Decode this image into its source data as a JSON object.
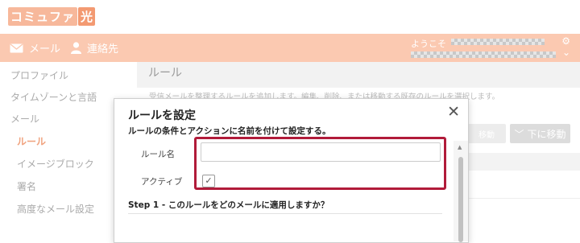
{
  "brand": {
    "logo_text": "コミュファ",
    "logo_hikari": "光"
  },
  "topnav": {
    "mail_label": "メール",
    "contacts_label": "連絡先",
    "welcome": "ようこそ"
  },
  "sidebar": {
    "items": [
      {
        "label": "プロファイル"
      },
      {
        "label": "タイムゾーンと言語"
      },
      {
        "label": "メール"
      },
      {
        "label": "ルール"
      },
      {
        "label": "イメージブロック"
      },
      {
        "label": "署名"
      },
      {
        "label": "高度なメール設定"
      }
    ]
  },
  "main": {
    "title": "ルール",
    "description": "受信メールを整理するルールを追加します。編集、削除、または移動する既存のルールを選択します。",
    "move_up_label": "移動",
    "move_down_label": "下に移動"
  },
  "modal": {
    "title": "ルールを設定",
    "subtitle": "ルールの条件とアクションに名前を付けて設定する。",
    "rule_name_label": "ルール名",
    "rule_name_value": "",
    "active_label": "アクティブ",
    "active_checked": true,
    "step1": "Step 1 - このルールをどのメールに適用しますか？"
  },
  "colors": {
    "nav_bg": "#fbc9b1",
    "accent": "#f0a37f",
    "highlight_border": "#b11b3a"
  }
}
